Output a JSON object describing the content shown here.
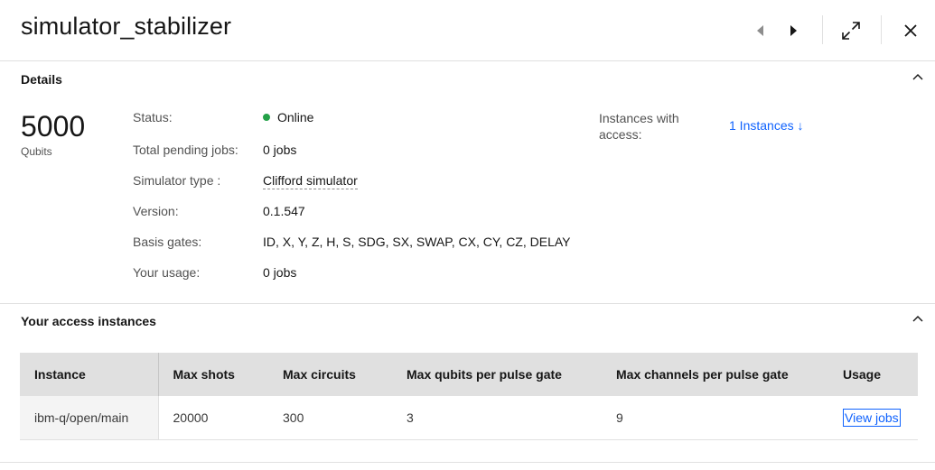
{
  "header": {
    "title": "simulator_stabilizer"
  },
  "details": {
    "section_title": "Details",
    "qubits_value": "5000",
    "qubits_label": "Qubits",
    "fields": {
      "status_label": "Status:",
      "status_value": "Online",
      "pending_label": "Total pending jobs:",
      "pending_value": "0 jobs",
      "simtype_label": "Simulator type :",
      "simtype_value": "Clifford simulator",
      "version_label": "Version:",
      "version_value": "0.1.547",
      "basis_label": "Basis gates:",
      "basis_value": "ID, X, Y, Z, H, S, SDG, SX, SWAP, CX, CY, CZ, DELAY",
      "usage_label": "Your usage:",
      "usage_value": "0 jobs"
    },
    "instances_label": "Instances with access:",
    "instances_link": "1 Instances ↓"
  },
  "access": {
    "section_title": "Your access instances",
    "columns": [
      "Instance",
      "Max shots",
      "Max circuits",
      "Max qubits per pulse gate",
      "Max channels per pulse gate",
      "Usage"
    ],
    "rows": [
      {
        "instance": "ibm-q/open/main",
        "max_shots": "20000",
        "max_circuits": "300",
        "max_qubits_pulse": "3",
        "max_channels_pulse": "9",
        "usage_link": "View jobs"
      }
    ]
  },
  "colors": {
    "accent": "#0f62fe",
    "status_online": "#24a148",
    "header_bg": "#e0e0e0"
  }
}
